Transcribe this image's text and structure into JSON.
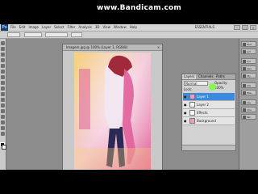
{
  "watermark": {
    "www": "www.",
    "brand": "Bandicam",
    "tld": ".com"
  },
  "app": {
    "logo": "Ps",
    "menu": [
      "File",
      "Edit",
      "Image",
      "Layer",
      "Select",
      "Filter",
      "Analysis",
      "3D",
      "View",
      "Window",
      "Help"
    ],
    "workspace": "ESSENTIALS",
    "window_buttons": [
      "–",
      "□",
      "×"
    ]
  },
  "document": {
    "title": "Imagem.jpg @ 100% (Layer 1, RGB/8)",
    "close": "×",
    "photo_colors": {
      "warm": "#f6d27a",
      "pink": "#e0609a",
      "light": "#f3c9d9",
      "shirt": "#f2e6f0",
      "hair": "#a02a3a",
      "jeans": "#2b2a55"
    }
  },
  "layers_panel": {
    "tabs": [
      "Layers",
      "Channels",
      "Paths"
    ],
    "blend_mode": "Normal",
    "opacity_label": "Opacity: 100%",
    "lock_label": "Lock:",
    "layers": [
      {
        "name": "Layer 1",
        "selected": true,
        "thumb": "pink"
      },
      {
        "name": "Layer 2",
        "selected": false,
        "thumb": "white"
      },
      {
        "name": "Effects",
        "selected": false,
        "thumb": "white"
      },
      {
        "name": "Background",
        "selected": false,
        "thumb": "pink"
      }
    ]
  },
  "dock": [
    {
      "icon": "history-icon",
      "label": "Hist"
    },
    {
      "icon": "actions-icon",
      "label": "Act"
    },
    {
      "icon": "color-icon",
      "label": "Col"
    },
    {
      "icon": "swatches-icon",
      "label": "Swa"
    },
    {
      "icon": "styles-icon",
      "label": "Sty"
    },
    {
      "icon": "adjustments-icon",
      "label": "Adj"
    },
    {
      "icon": "masks-icon",
      "label": "Mas"
    },
    {
      "icon": "layers-icon",
      "label": "Lay"
    },
    {
      "icon": "channels-icon",
      "label": "Cha"
    },
    {
      "icon": "paths-icon",
      "label": "Pat"
    }
  ]
}
